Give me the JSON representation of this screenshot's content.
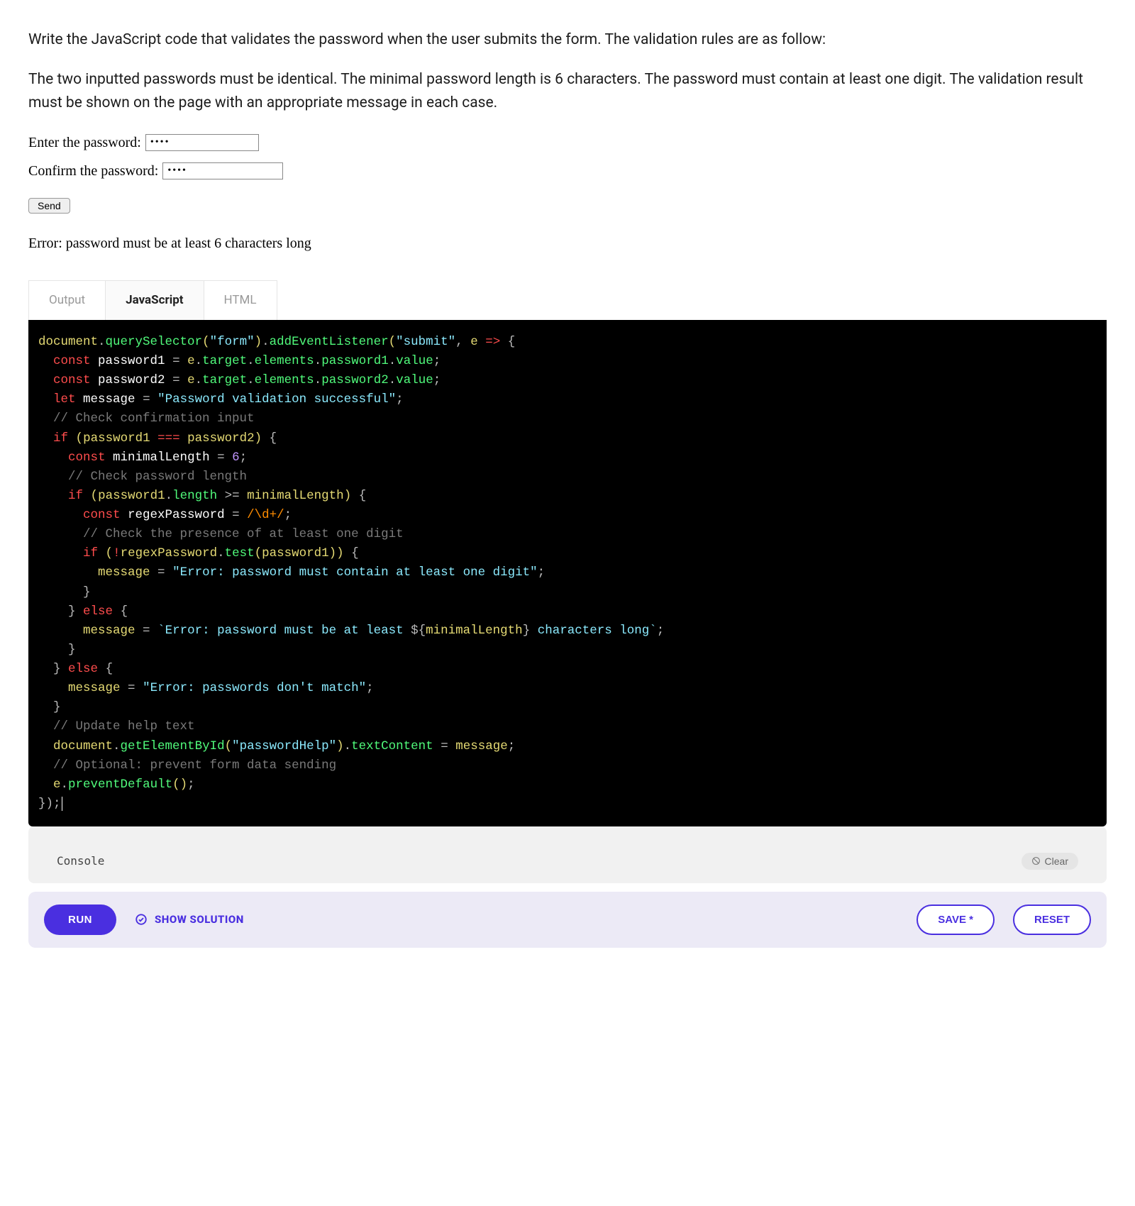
{
  "prose": {
    "p1": "Write the JavaScript code that validates the password when the user submits the form. The validation rules are as follow:",
    "p2": "The two inputted passwords must be identical. The minimal password length is 6 characters. The password must contain at least one digit. The validation result must be shown on the page with an appropriate message in each case."
  },
  "example": {
    "label_enter": "Enter the password:",
    "label_confirm": "Confirm the password:",
    "field1_value": "••••",
    "field2_value": "••••",
    "send_label": "Send",
    "error_text": "Error: password must be at least 6 characters long"
  },
  "tabs": {
    "output": "Output",
    "javascript": "JavaScript",
    "html": "HTML",
    "active": "javascript"
  },
  "code": {
    "s_form": "\"form\"",
    "s_submit": "\"submit\"",
    "s_success": "\"Password validation successful\"",
    "s_digit_err": "\"Error: password must contain at least one digit\"",
    "s_len_err_a": "`Error: password must be at least ",
    "s_len_err_b": " characters long`",
    "s_nomatch": "\"Error: passwords don't match\"",
    "s_helpid": "\"passwordHelp\"",
    "cmt_confirm": "// Check confirmation input",
    "cmt_len": "// Check password length",
    "cmt_digit": "// Check the presence of at least one digit",
    "cmt_upd": "// Update help text",
    "cmt_opt": "// Optional: prevent form data sending",
    "num_six": "6",
    "regex": "/\\d+/"
  },
  "console": {
    "title": "Console",
    "clear": "Clear"
  },
  "actions": {
    "run": "RUN",
    "show_solution": "SHOW SOLUTION",
    "save": "SAVE *",
    "reset": "RESET"
  },
  "colors": {
    "accent": "#4a2fe0"
  }
}
